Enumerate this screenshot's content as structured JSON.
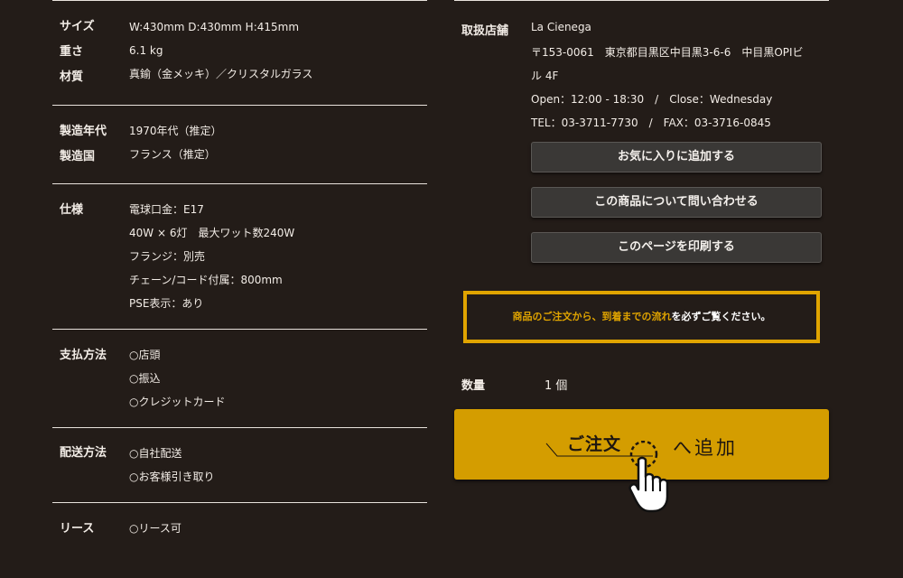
{
  "spec": {
    "size_label": "サイズ",
    "size_value": "W:430mm D:430mm H:415mm",
    "weight_label": "重さ",
    "weight_value": "6.1 kg",
    "material_label": "材質",
    "material_value": "真鍮（金メッキ）／クリスタルガラス",
    "era_label": "製造年代",
    "era_value": "1970年代（推定）",
    "country_label": "製造国",
    "country_value": "フランス（推定）",
    "specs_label": "仕様",
    "specs_lines": [
      "電球口金：E17",
      "40W × 6灯　最大ワット数240W",
      "フランジ：別売",
      "チェーン/コード付属：800mm",
      "PSE表示：あり"
    ],
    "payment_label": "支払方法",
    "payment_lines": [
      "○店頭",
      "○振込",
      "○クレジットカード"
    ],
    "delivery_label": "配送方法",
    "delivery_lines": [
      "○自社配送",
      "○お客様引き取り"
    ],
    "lease_label": "リース",
    "lease_lines": [
      "○リース可"
    ]
  },
  "shop": {
    "label": "取扱店舗",
    "name": "La Cienega",
    "address_line1": "〒153-0061　東京都目黒区中目黒3-6-6　中目黒OPIビ",
    "address_line2": "ル 4F",
    "hours": "Open：12:00 - 18:30　/　Close：Wednesday",
    "contact": "TEL：03-3711-7730　/　FAX：03-3716-0845"
  },
  "buttons": {
    "favorite": "お気に入りに追加する",
    "inquire": "この商品について問い合わせる",
    "print": "このページを印刷する"
  },
  "notice": {
    "highlight": "商品のご注文から、到着までの流れ",
    "rest": "を必ずご覧ください。"
  },
  "quantity": {
    "label": "数量",
    "value": "1 個"
  },
  "order": {
    "main": "ご注文",
    "sub": "へ追加"
  },
  "colors": {
    "background": "#231c18",
    "accent": "#d49d00",
    "notice_border": "#e0a400"
  }
}
